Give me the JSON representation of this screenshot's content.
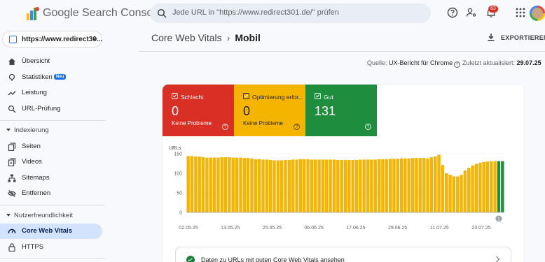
{
  "header": {
    "app_name": "Google Search Console",
    "search_placeholder": "Jede URL in \"https://www.redirect301.de/\" prüfen",
    "notification_count": "63"
  },
  "sidebar": {
    "property": "https://www.redirect30...",
    "items": [
      {
        "label": "Übersicht"
      },
      {
        "label": "Statistiken",
        "tag": "Neu"
      },
      {
        "label": "Leistung"
      },
      {
        "label": "URL-Prüfung"
      }
    ],
    "section_indexing": "Indexierung",
    "indexing_items": [
      {
        "label": "Seiten"
      },
      {
        "label": "Videos"
      },
      {
        "label": "Sitemaps"
      },
      {
        "label": "Entfernen"
      }
    ],
    "section_ux": "Nutzerfreundlichkeit",
    "ux_items": [
      {
        "label": "Core Web Vitals"
      },
      {
        "label": "HTTPS"
      }
    ]
  },
  "breadcrumb": {
    "parent": "Core Web Vitals",
    "current": "Mobil"
  },
  "export_label": "EXPORTIEREN",
  "source": {
    "label": "Quelle:",
    "value": "UX-Bericht für Chrome",
    "updated_label": "Zuletzt aktualisiert:",
    "updated_value": "29.07.25"
  },
  "tiles": [
    {
      "label": "Schlecht",
      "value": "0",
      "sub": "Keine Probleme",
      "color": "#d93025"
    },
    {
      "label": "Optimierung erfor...",
      "value": "0",
      "sub": "Keine Probleme",
      "color": "#f4b400"
    },
    {
      "label": "Gut",
      "value": "131",
      "sub": "",
      "color": "#1e8e3e"
    }
  ],
  "info_bar": "Daten zu URLs mit guten Core Web Vitals ansehen",
  "annotation_marker": "1",
  "chart_data": {
    "type": "bar",
    "ylabel": "URLs",
    "ylim": [
      0,
      150
    ],
    "yticks": [
      "150",
      "100",
      "50",
      "0"
    ],
    "xticks": [
      "02.05.25",
      "13.05.25",
      "25.05.25",
      "06.06.25",
      "17.06.25",
      "29.06.25",
      "11.07.25",
      "23.07.25"
    ],
    "series": [
      {
        "color": "#f4b400",
        "values": [
          144,
          144,
          143,
          143,
          141,
          140,
          140,
          140,
          140,
          141,
          141,
          141,
          140,
          140,
          140,
          139,
          139,
          138,
          136,
          136,
          135,
          135,
          134,
          133,
          133,
          133,
          134,
          134,
          135,
          135,
          136,
          136,
          136,
          135,
          135,
          135,
          135,
          135,
          135,
          135,
          134,
          134,
          134,
          134,
          134,
          134,
          135,
          135,
          135,
          135,
          135,
          136,
          136,
          136,
          137,
          137,
          137,
          138,
          138,
          138,
          139,
          139,
          139,
          139,
          138,
          141,
          143,
          147,
          121,
          100,
          96,
          92,
          92,
          96,
          107,
          114,
          120,
          124,
          127,
          129,
          130,
          131,
          131,
          0,
          0
        ]
      },
      {
        "color": "#1e8e3e",
        "values": [
          0,
          0,
          0,
          0,
          0,
          0,
          0,
          0,
          0,
          0,
          0,
          0,
          0,
          0,
          0,
          0,
          0,
          0,
          0,
          0,
          0,
          0,
          0,
          0,
          0,
          0,
          0,
          0,
          0,
          0,
          0,
          0,
          0,
          0,
          0,
          0,
          0,
          0,
          0,
          0,
          0,
          0,
          0,
          0,
          0,
          0,
          0,
          0,
          0,
          0,
          0,
          0,
          0,
          0,
          0,
          0,
          0,
          0,
          0,
          0,
          0,
          0,
          0,
          0,
          0,
          0,
          0,
          0,
          0,
          0,
          0,
          0,
          0,
          0,
          0,
          0,
          0,
          0,
          0,
          0,
          0,
          0,
          0,
          131,
          131
        ]
      }
    ]
  }
}
